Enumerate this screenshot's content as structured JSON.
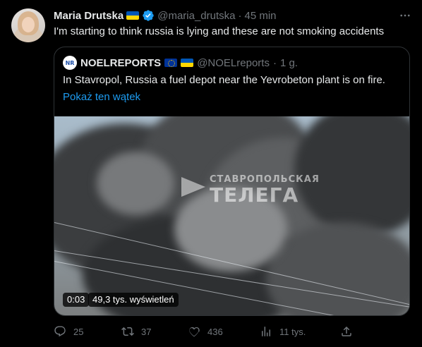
{
  "tweet": {
    "author_name": "Maria Drutska",
    "author_handle": "@maria_drutska",
    "separator": "·",
    "time": "45 min",
    "text": "I'm starting to think russia is lying and these are not smoking accidents"
  },
  "quote": {
    "author_name": "NOELREPORTS",
    "author_handle": "@NOELreports",
    "separator": "·",
    "time": "1 g.",
    "avatar_text": "NR",
    "text": "In Stavropol, Russia a fuel depot near the Yevrobeton plant is on fire.",
    "show_thread": "Pokaż ten wątek",
    "media": {
      "watermark_line1": "СТАВРОПОЛЬСКАЯ",
      "watermark_line2": "ТЕЛЕГА",
      "duration": "0:03",
      "views": "49,3 tys. wyświetleń"
    }
  },
  "actions": {
    "replies": "25",
    "retweets": "37",
    "likes": "436",
    "views": "11 tys."
  },
  "colors": {
    "background": "#000000",
    "text": "#e7e9ea",
    "muted": "#71767b",
    "link": "#1d9bf0",
    "border": "#2f3336",
    "verified": "#1d9bf0"
  },
  "icons": [
    "more-icon",
    "verified-icon",
    "ukraine-flag-icon",
    "eu-flag-icon",
    "reply-icon",
    "retweet-icon",
    "like-icon",
    "views-icon",
    "share-icon"
  ]
}
